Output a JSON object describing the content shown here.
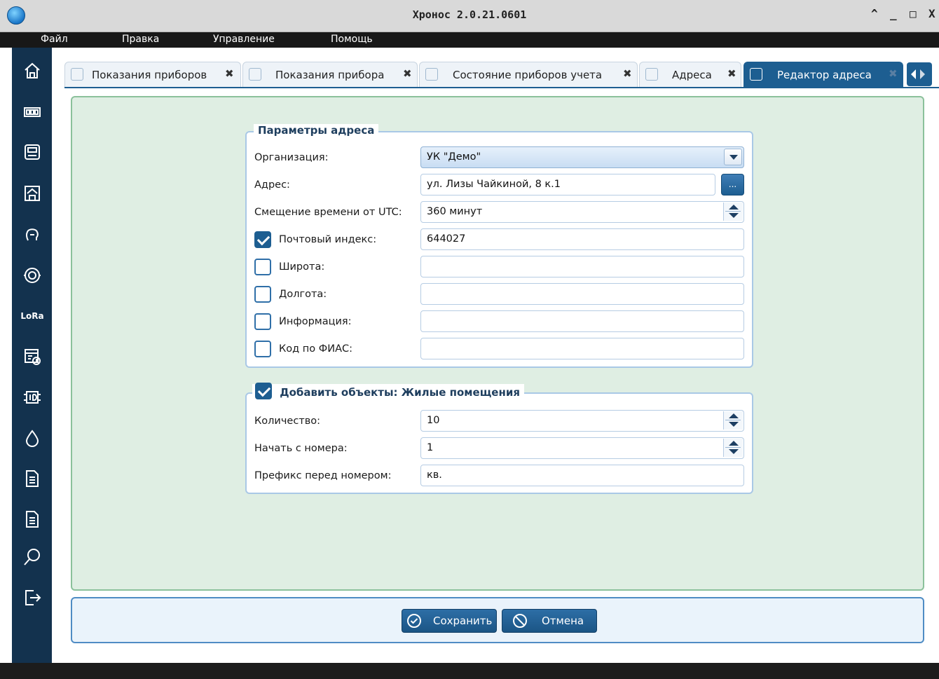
{
  "window": {
    "title": "Хронос 2.0.21.0601",
    "controls": [
      "^",
      "_",
      "□",
      "X"
    ]
  },
  "menu": [
    "Файл",
    "Правка",
    "Управление",
    "Помощь"
  ],
  "sidebar": {
    "icons": [
      "home-icon",
      "counter-icon",
      "meter-device-icon",
      "building-icon",
      "head-icon",
      "gauge-icon",
      "lora-icon",
      "schedule-icon",
      "id-icon",
      "water-drop-icon",
      "document-icon",
      "document-2-icon",
      "search-icon",
      "exit-icon"
    ],
    "lora_label": "LoRa"
  },
  "tabs": [
    {
      "label": "Показания приборов",
      "icon": "table-icon",
      "active": false
    },
    {
      "label": "Показания прибора",
      "icon": "chart-icon",
      "active": false
    },
    {
      "label": "Состояние приборов учета",
      "icon": "meter-icon",
      "active": false
    },
    {
      "label": "Адреса",
      "icon": "building-icon",
      "active": false
    },
    {
      "label": "Редактор адреса",
      "icon": "new-document-icon",
      "active": true
    }
  ],
  "tab_close": "✖",
  "address_params": {
    "title": "Параметры адреса",
    "organization_label": "Организация:",
    "organization_value": "УК \"Демо\"",
    "address_label": "Адрес:",
    "address_value": "ул. Лизы Чайкиной, 8 к.1",
    "address_button": "...",
    "utc_label": "Смещение времени от UTC:",
    "utc_value": "360  минут",
    "postal_label": "Почтовый индекс:",
    "postal_checked": true,
    "postal_value": "644027",
    "latitude_label": "Широта:",
    "latitude_checked": false,
    "latitude_value": "",
    "longitude_label": "Долгота:",
    "longitude_checked": false,
    "longitude_value": "",
    "info_label": "Информация:",
    "info_checked": false,
    "info_value": "",
    "fias_label": "Код по ФИАС:",
    "fias_checked": false,
    "fias_value": ""
  },
  "add_objects": {
    "title": "Добавить объекты: Жилые помещения",
    "checked": true,
    "count_label": "Количество:",
    "count_value": "10",
    "start_label": "Начать с номера:",
    "start_value": "1",
    "prefix_label": "Префикс перед номером:",
    "prefix_value": "кв."
  },
  "actions": {
    "save_label": "Сохранить",
    "cancel_label": "Отмена"
  },
  "colors": {
    "accent": "#1d5e91",
    "sidebar": "#13324e",
    "panel": "#dfeee3"
  }
}
